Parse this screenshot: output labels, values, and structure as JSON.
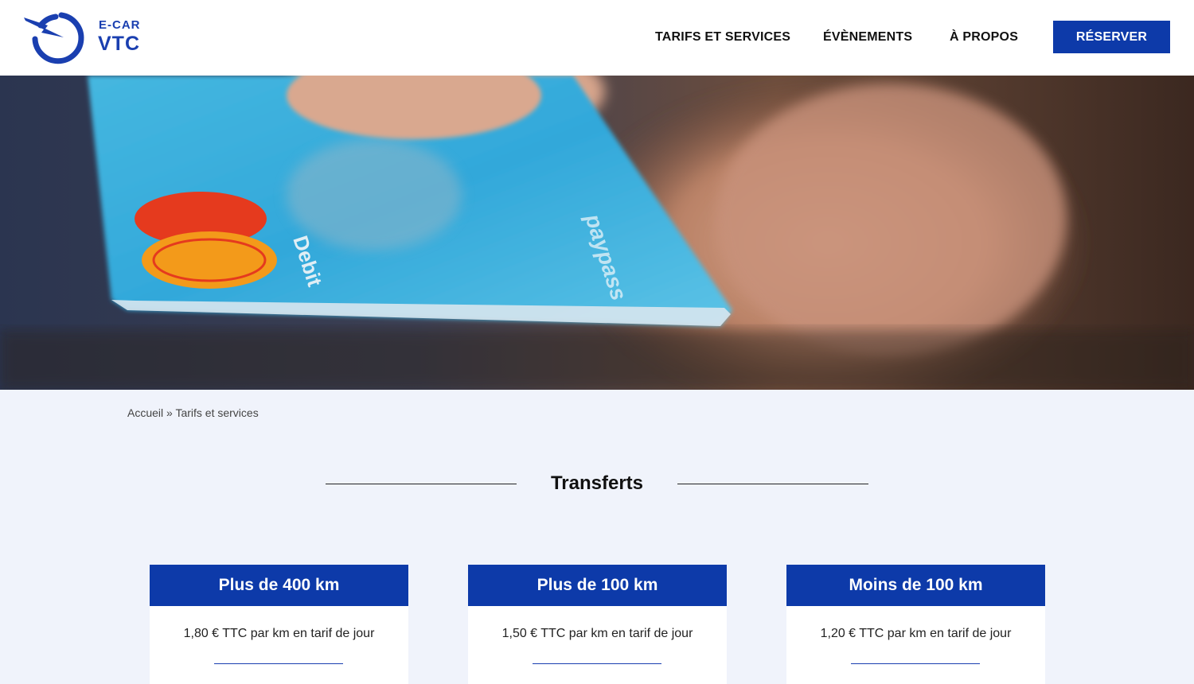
{
  "header": {
    "logo_top": "E-CAR",
    "logo_bottom": "VTC",
    "nav": [
      "TARIFS ET SERVICES",
      "ÉVÈNEMENTS",
      "À PROPOS"
    ],
    "cta_label": "RÉSERVER",
    "brand_color": "#0d3aa9"
  },
  "hero": {
    "card_lettering": [
      "Debit",
      "paypass"
    ]
  },
  "breadcrumb": {
    "home": "Accueil",
    "separator": " » ",
    "current": "Tarifs et services"
  },
  "section": {
    "title": "Transferts"
  },
  "cards": [
    {
      "title": "Plus de 400 km",
      "text": "1,80 € TTC par km en tarif de jour"
    },
    {
      "title": "Plus de 100 km",
      "text": "1,50 € TTC par km en tarif de jour"
    },
    {
      "title": "Moins de 100 km",
      "text": "1,20 € TTC par km en tarif de jour"
    }
  ]
}
